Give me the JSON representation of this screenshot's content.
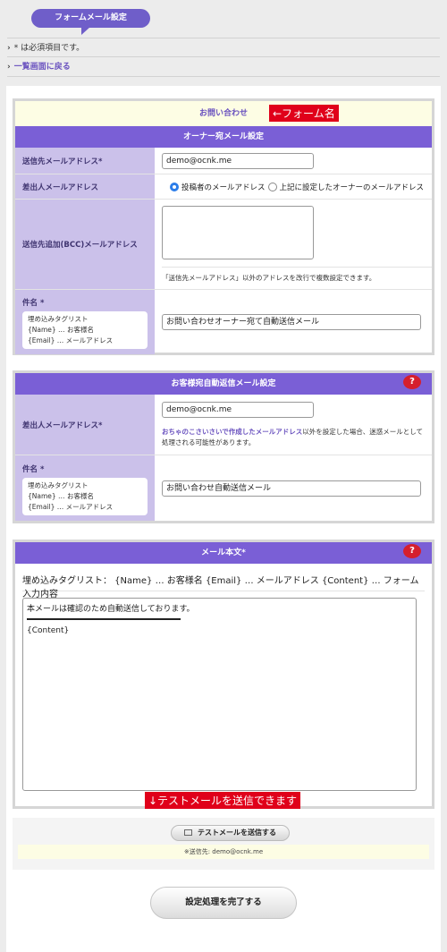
{
  "header": {
    "title": "フォームメール設定"
  },
  "info": {
    "required_note": "* は必須項目です。",
    "back_link": "一覧画面に戻る"
  },
  "owner_section": {
    "form_name": "お問い合わせ",
    "form_name_annotation": "←フォーム名",
    "heading": "オーナー宛メール設定",
    "to_label": "送信先メールアドレス*",
    "to_value": "demo@ocnk.me",
    "from_label": "差出人メールアドレス",
    "from_option1": "投稿者のメールアドレス",
    "from_option2": "上記に設定したオーナーのメールアドレス",
    "bcc_label": "送信先追加(BCC)メールアドレス",
    "bcc_note": "「送信先メールアドレス」以外のアドレスを改行で複数設定できます。",
    "subject_label": "件名 *",
    "subject_value": "お問い合わせオーナー宛て自動送信メール",
    "tag_list": {
      "title": "埋め込みタグリスト",
      "name": "{Name} … お客様名",
      "email": "{Email} … メールアドレス"
    }
  },
  "customer_section": {
    "heading": "お客様宛自動返信メール設定",
    "help_icon_text": "?",
    "from_label": "差出人メールアドレス*",
    "from_value": "demo@ocnk.me",
    "note_highlight": "おちゃのこさいさいで作成したメールアドレス",
    "note_rest": "以外を設定した場合、迷惑メールとして処理される可能性があります。",
    "subject_label": "件名 *",
    "subject_value": "お問い合わせ自動送信メール",
    "tag_list": {
      "title": "埋め込みタグリスト",
      "name": "{Name} … お客様名",
      "email": "{Email} … メールアドレス"
    }
  },
  "body_section": {
    "heading": "メール本文*",
    "help_icon_text": "?",
    "tags_line": "埋め込みタグリスト：  {Name} … お客様名  {Email} … メールアドレス  {Content} … フォーム入力内容",
    "body_line1": "本メールは確認のため自動送信しております。",
    "body_line2": "{Content}",
    "test_annotation": "↓テストメールを送信できます"
  },
  "test": {
    "button_label": "テストメールを送信する",
    "sent_to": "※送信先: demo@ocnk.me"
  },
  "complete_button": "設定処理を完了する"
}
